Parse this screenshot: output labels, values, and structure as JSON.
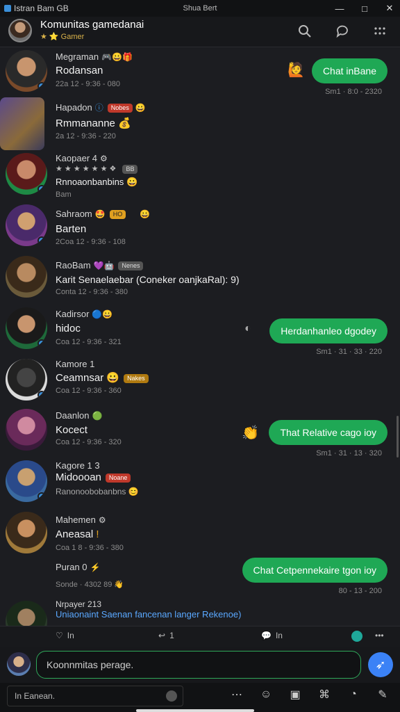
{
  "titlebar": {
    "app": "Istran Bam GB",
    "center": "Shua Bert"
  },
  "header": {
    "group_name": "Komunitas gamedanai",
    "subtitle": "Gamer"
  },
  "messages": [
    {
      "name": "Megraman",
      "text": "Rodansan",
      "time": "22a 12 - 9:36 - 080",
      "tag": "",
      "tagcolor": "#000",
      "outgoing": "Chat inBane",
      "out_time": "Sm1 · 8:0 - 2320"
    },
    {
      "name": "Hapadon",
      "text": "Rmmananne",
      "time": "2a 12 - 9:36 - 220",
      "tag": "Nobes",
      "tagcolor": "#c0392b"
    },
    {
      "name": "Kaopaer 4",
      "text": "Rnnoaonbanbins",
      "time": "Bam",
      "tag": "BB",
      "tagcolor": "#555"
    },
    {
      "name": "Sahraom",
      "text": "Barten",
      "time": "2Coa 12 - 9:36 - 108",
      "tag": "HO",
      "tagcolor": "#e0a020"
    },
    {
      "name": "RaoBam",
      "text": "Karit Senaelaebar (Coneker oanjkaRal): 9)",
      "time": "Conta 12 - 9:36 - 380",
      "tag": "Nenes",
      "tagcolor": "#555"
    },
    {
      "name": "Kadirsor",
      "text": "hidoc",
      "time": "Coa 12 - 9:36 - 321",
      "tag": "",
      "tagcolor": "#000",
      "outgoing": "Herdanhanleo dgodey",
      "out_time": "Sm1 · 31 · 33 · 220"
    },
    {
      "name": "Kamore 1",
      "text": "Ceamnsar",
      "time": "Coa 12 - 9:36 - 360",
      "tag": "Nakes",
      "tagcolor": "#b07a10"
    },
    {
      "name": "Daanlon",
      "text": "Kocect",
      "time": "Coa 12 - 9:36 - 320",
      "tag": "",
      "tagcolor": "#000",
      "outgoing": "That Relative cago ioy",
      "out_time": "Sm1 · 31 · 13 · 320"
    },
    {
      "name": "Kagore 1 3",
      "text": "Midoooan",
      "time": "Ranonoobobanbns",
      "tag": "Noane",
      "tagcolor": "#c0392b"
    },
    {
      "name": "Mahemen",
      "text": "Aneasal",
      "time": "Coa 1 8 - 9:36 - 380",
      "tag": "",
      "tagcolor": "#000"
    },
    {
      "name": "Puran 0",
      "text": "",
      "time": "Sonde · 4302 89",
      "tag": "",
      "tagcolor": "#000",
      "outgoing": "Chat Cetpennekaire tgon ioy",
      "out_time": "80 - 13 - 200"
    },
    {
      "name": "Nrpayer 213",
      "text": "Uniaonaint Saenan fancenan langer Rekenoe)",
      "time": "",
      "tag": "",
      "tagcolor": "#000"
    }
  ],
  "reactbar": {
    "likes": "In",
    "replies": "1",
    "comments": "In"
  },
  "composer": {
    "placeholder": "Koonnmitas perage."
  },
  "bottombar": {
    "search": "In Eanean."
  },
  "colors": {
    "accent_green": "#1fa855",
    "send_blue": "#3b82f6"
  }
}
